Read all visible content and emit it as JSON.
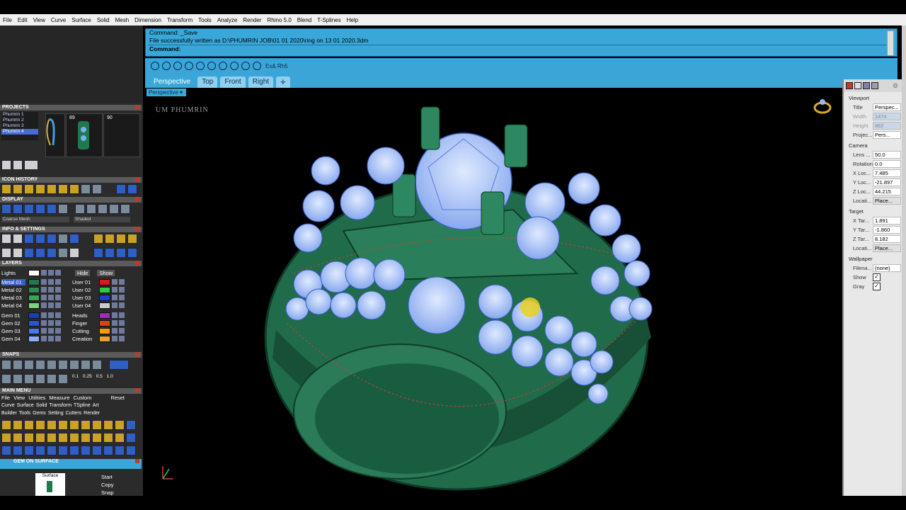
{
  "menu": [
    "File",
    "Edit",
    "View",
    "Curve",
    "Surface",
    "Solid",
    "Mesh",
    "Dimension",
    "Transform",
    "Tools",
    "Analyze",
    "Render",
    "Rhino 5.0",
    "Blend",
    "T-Splines",
    "Help"
  ],
  "command": {
    "line1": "Command: _Save",
    "line2": "File successfully written as D:\\PHUMRIN JOB\\01 01 2020\\ring on 13 01 2020.3dm",
    "prompt": "Command:"
  },
  "toolbar_label": "Ex& Rh5",
  "tabs": [
    "Perspective",
    "Top",
    "Front",
    "Right"
  ],
  "viewport_dropdown": "Perspective",
  "watermark": "UM PHUMRIN",
  "left": {
    "projects_title": "PROJECTS",
    "projects": [
      "Phumrin 1",
      "Phumrin 2",
      "Phumrin 3",
      "Phumrin 4"
    ],
    "project_selected": 3,
    "thumb_labels": [
      "89",
      "90"
    ],
    "icon_history_title": "ICON HISTORY",
    "display_title": "DISPLAY",
    "display_modes": [
      "Coarse Mesh",
      "Shaded"
    ],
    "info_title": "INFO & SETTINGS",
    "layers_title": "LAYERS",
    "layers_header": {
      "lights": "Lights",
      "hide": "Hide",
      "show": "Show"
    },
    "layers_left": [
      {
        "name": "Metal 01",
        "color": "#1e7a4d"
      },
      {
        "name": "Metal 02",
        "color": "#2e8b57"
      },
      {
        "name": "Metal 03",
        "color": "#34a853"
      },
      {
        "name": "Metal 04",
        "color": "#7cd47c"
      },
      {
        "name": "Gem 01",
        "color": "#1a3fb0"
      },
      {
        "name": "Gem 02",
        "color": "#2a55d0"
      },
      {
        "name": "Gem 03",
        "color": "#4a7ae8"
      },
      {
        "name": "Gem 04",
        "color": "#8ab0f5"
      }
    ],
    "layers_right": [
      {
        "name": "User 01",
        "color": "#d81b1b"
      },
      {
        "name": "User 02",
        "color": "#2ecc40"
      },
      {
        "name": "User 03",
        "color": "#1a40d0"
      },
      {
        "name": "User 04",
        "color": "#cccccc"
      },
      {
        "name": "Heads",
        "color": "#9b2fb0"
      },
      {
        "name": "Finger",
        "color": "#d84315"
      },
      {
        "name": "Cutting",
        "color": "#f39c12"
      },
      {
        "name": "Creation",
        "color": "#f0a030"
      }
    ],
    "snaps_title": "SNAPS",
    "snap_values": [
      "0.1",
      "0.25",
      "0.5",
      "1.0"
    ],
    "main_menu_title": "MAIN MENU",
    "main_menu_items": [
      "File",
      "View",
      "Utilities",
      "Measure",
      "Custom"
    ],
    "main_menu_reset": "Reset",
    "main_menu_row2": [
      "Curve",
      "Surface",
      "Solid",
      "Transform",
      "TSpline",
      "Art"
    ],
    "main_menu_row3": [
      "Builder",
      "Tools",
      "Gems",
      "Setting",
      "Cutters",
      "Render"
    ],
    "gem_title": "GEM ON SURFACE",
    "gem_surface": "Surface",
    "gem_buttons": [
      "Start",
      "Copy",
      "Snap"
    ]
  },
  "props": {
    "viewport_title": "Viewport",
    "title_label": "Title",
    "title_value": "Perspec...",
    "width_label": "Width",
    "width_value": "1474",
    "height_label": "Height",
    "height_value": "862",
    "projection_label": "Projec...",
    "projection_value": "Pers...",
    "camera_title": "Camera",
    "lens_label": "Lens ...",
    "lens_value": "50.0",
    "rotation_label": "Rotation",
    "rotation_value": "0.0",
    "xloc_label": "X Loc...",
    "xloc_value": "7.485",
    "yloc_label": "Y Loc...",
    "yloc_value": "-21.897",
    "zloc_label": "Z Loc...",
    "zloc_value": "44.215",
    "location_label": "Locati...",
    "location_value": "Place...",
    "target_title": "Target",
    "xtar_label": "X Tar...",
    "xtar_value": "1.891",
    "ytar_label": "Y Tar...",
    "ytar_value": "-1.860",
    "ztar_label": "Z Tar...",
    "ztar_value": "8.182",
    "tlocation_label": "Locati...",
    "tlocation_value": "Place...",
    "wallpaper_title": "Wallpaper",
    "filename_label": "Filena...",
    "filename_value": "(none)",
    "show_label": "Show",
    "gray_label": "Gray"
  }
}
